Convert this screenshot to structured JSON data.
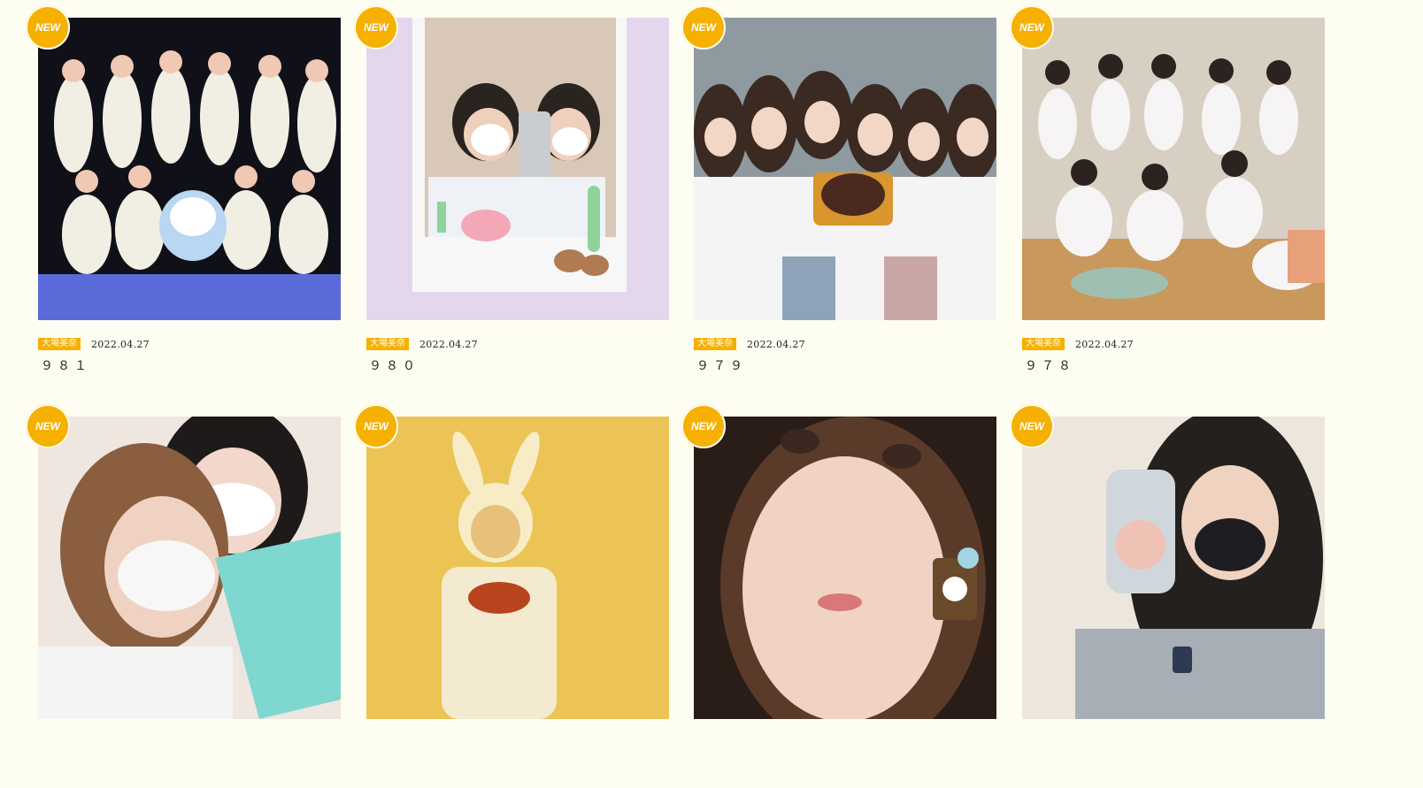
{
  "colors": {
    "page_bg": "#fefdf1",
    "accent": "#f5b000"
  },
  "posts": [
    {
      "badge": "NEW",
      "tag": "大場美奈",
      "date": "2022.04.27",
      "number": "９８１",
      "photo_icon": "group-stage-photo"
    },
    {
      "badge": "NEW",
      "tag": "大場美奈",
      "date": "2022.04.27",
      "number": "９８０",
      "photo_icon": "polaroid-selfie-photo"
    },
    {
      "badge": "NEW",
      "tag": "大場美奈",
      "date": "2022.04.27",
      "number": "９７９",
      "photo_icon": "birthday-cake-group-photo"
    },
    {
      "badge": "NEW",
      "tag": "大場美奈",
      "date": "2022.04.27",
      "number": "９７８",
      "photo_icon": "rehearsal-group-photo"
    },
    {
      "badge": "NEW",
      "tag": "",
      "date": "",
      "number": "",
      "photo_icon": "masked-selfie-photo"
    },
    {
      "badge": "NEW",
      "tag": "",
      "date": "",
      "number": "",
      "photo_icon": "bunny-hat-photo"
    },
    {
      "badge": "NEW",
      "tag": "",
      "date": "",
      "number": "",
      "photo_icon": "closeup-face-photo"
    },
    {
      "badge": "NEW",
      "tag": "",
      "date": "",
      "number": "",
      "photo_icon": "phone-case-photo"
    }
  ]
}
